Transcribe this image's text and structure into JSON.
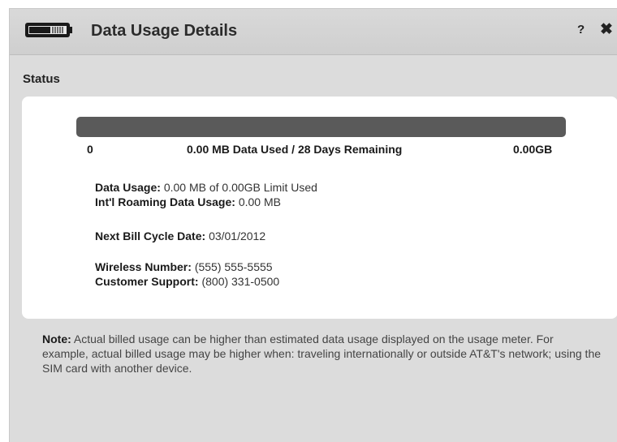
{
  "window": {
    "title": "Data Usage Details",
    "help_label": "?",
    "close_label": "✖"
  },
  "status": {
    "heading": "Status"
  },
  "meter": {
    "min_label": "0",
    "center_label": "0.00 MB Data Used / 28 Days Remaining",
    "max_label": "0.00GB",
    "used_fraction": 0,
    "track_color": "#5a5a5a"
  },
  "details": {
    "data_usage_label": "Data Usage:",
    "data_usage_value": "0.00 MB of 0.00GB Limit Used",
    "roaming_label": "Int'l Roaming Data Usage:",
    "roaming_value": "0.00 MB",
    "bill_cycle_label": "Next Bill Cycle Date:",
    "bill_cycle_value": "03/01/2012",
    "wireless_label": "Wireless Number:",
    "wireless_value": "(555) 555-5555",
    "support_label": "Customer Support:",
    "support_value": "(800) 331-0500"
  },
  "note": {
    "label": "Note:",
    "text": "Actual billed usage can be higher than estimated data usage displayed on the usage meter. For example, actual billed usage may be higher when: traveling internationally or outside AT&T's network; using the SIM card with another device."
  },
  "icons": {
    "battery": "battery-icon",
    "help": "help-icon",
    "close": "close-icon"
  }
}
